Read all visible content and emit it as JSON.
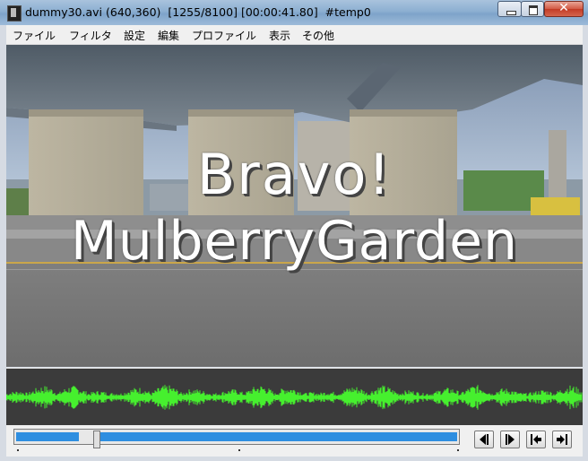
{
  "window": {
    "title": "dummy30.avi (640,360)  [1255/8100] [00:00:41.80]  #temp0",
    "controls": {
      "close_symbol": "✕"
    }
  },
  "menu": [
    {
      "label": "ファイル"
    },
    {
      "label": "フィルタ"
    },
    {
      "label": "設定"
    },
    {
      "label": "編集"
    },
    {
      "label": "プロファイル"
    },
    {
      "label": "表示"
    },
    {
      "label": "その他"
    }
  ],
  "video": {
    "caption_line1": "Bravo!",
    "caption_line2": "MulberryGarden"
  },
  "playback": {
    "position_fraction": 0.155
  },
  "nav_buttons": [
    {
      "name": "prev-frame-button",
      "icon": "step-back-icon"
    },
    {
      "name": "next-frame-button",
      "icon": "step-forward-icon"
    },
    {
      "name": "jump-start-button",
      "icon": "go-to-start-icon"
    },
    {
      "name": "jump-end-button",
      "icon": "go-to-end-icon"
    }
  ],
  "colors": {
    "waveform": "#46f02e",
    "seek_fill": "#2e8ee0"
  }
}
